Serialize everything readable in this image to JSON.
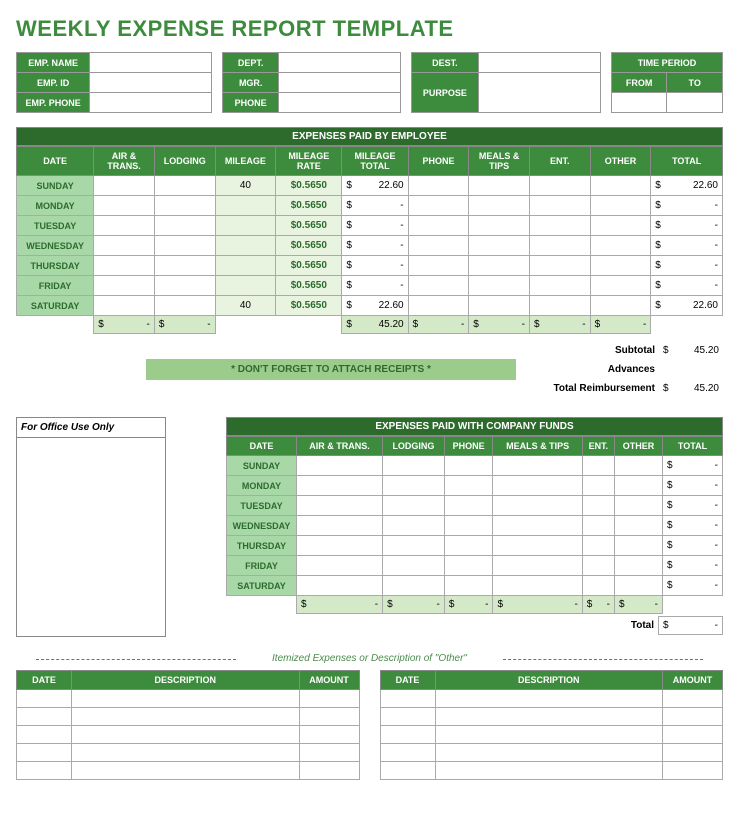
{
  "title": "WEEKLY EXPENSE REPORT TEMPLATE",
  "info": {
    "empName": "EMP. NAME",
    "empId": "EMP. ID",
    "empPhone": "EMP. PHONE",
    "dept": "DEPT.",
    "mgr": "MGR.",
    "phone": "PHONE",
    "dest": "DEST.",
    "purpose": "PURPOSE",
    "timePeriod": "TIME PERIOD",
    "from": "FROM",
    "to": "TO"
  },
  "empHdr": "EXPENSES PAID BY EMPLOYEE",
  "cols": {
    "date": "DATE",
    "air": "AIR & TRANS.",
    "lodging": "LODGING",
    "mileage": "MILEAGE",
    "mrate": "MILEAGE RATE",
    "mtotal": "MILEAGE TOTAL",
    "phone": "PHONE",
    "meals": "MEALS & TIPS",
    "ent": "ENT.",
    "other": "OTHER",
    "total": "TOTAL"
  },
  "days": [
    "SUNDAY",
    "MONDAY",
    "TUESDAY",
    "WEDNESDAY",
    "THURSDAY",
    "FRIDAY",
    "SATURDAY"
  ],
  "empRows": [
    {
      "mileage": "40",
      "rate": "$0.5650",
      "mtotal": "22.60",
      "total": "22.60"
    },
    {
      "mileage": "",
      "rate": "$0.5650",
      "mtotal": "-",
      "total": "-"
    },
    {
      "mileage": "",
      "rate": "$0.5650",
      "mtotal": "-",
      "total": "-"
    },
    {
      "mileage": "",
      "rate": "$0.5650",
      "mtotal": "-",
      "total": "-"
    },
    {
      "mileage": "",
      "rate": "$0.5650",
      "mtotal": "-",
      "total": "-"
    },
    {
      "mileage": "",
      "rate": "$0.5650",
      "mtotal": "-",
      "total": "-"
    },
    {
      "mileage": "40",
      "rate": "$0.5650",
      "mtotal": "22.60",
      "total": "22.60"
    }
  ],
  "empSum": {
    "air": "-",
    "lodging": "-",
    "mtotal": "45.20",
    "phone": "-",
    "meals": "-",
    "ent": "-",
    "other": "-"
  },
  "reminder": "* DON'T FORGET TO ATTACH RECEIPTS *",
  "subtotal": {
    "label": "Subtotal",
    "val": "45.20"
  },
  "advances": {
    "label": "Advances",
    "val": ""
  },
  "reimb": {
    "label": "Total Reimbursement",
    "val": "45.20"
  },
  "officeLabel": "For Office Use Only",
  "compHdr": "EXPENSES PAID WITH COMPANY FUNDS",
  "compRows": [
    {
      "total": "-"
    },
    {
      "total": "-"
    },
    {
      "total": "-"
    },
    {
      "total": "-"
    },
    {
      "total": "-"
    },
    {
      "total": "-"
    },
    {
      "total": "-"
    }
  ],
  "compSum": {
    "air": "-",
    "lodging": "-",
    "phone": "-",
    "meals": "-",
    "ent": "-",
    "other": "-"
  },
  "compTotal": {
    "label": "Total",
    "val": "-"
  },
  "itemizedTitle": "Itemized Expenses or Description of \"Other\"",
  "itemCols": {
    "date": "DATE",
    "desc": "DESCRIPTION",
    "amount": "AMOUNT"
  },
  "dollar": "$"
}
